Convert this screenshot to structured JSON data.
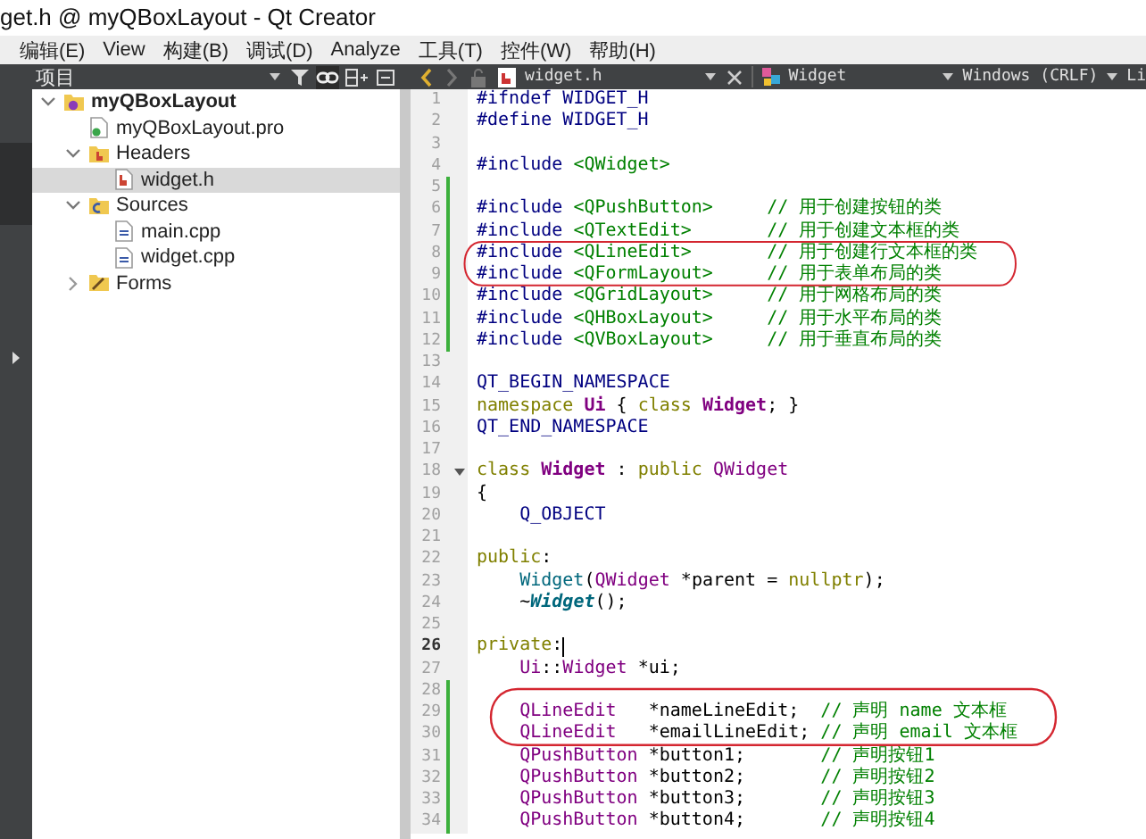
{
  "window": {
    "title": "get.h @ myQBoxLayout - Qt Creator"
  },
  "menu": [
    "编辑(E)",
    "View",
    "构建(B)",
    "调试(D)",
    "Analyze",
    "工具(T)",
    "控件(W)",
    "帮助(H)"
  ],
  "toolbar": {
    "panel_title": "项目",
    "file": "widget.h",
    "symbol": "Widget",
    "line_endings": "Windows (CRLF)",
    "combo_4": "Li"
  },
  "project_tree": {
    "items": [
      {
        "label": "myQBoxLayout",
        "kind": "project",
        "expanded": true,
        "selected": false,
        "children": [
          {
            "label": "myQBoxLayout.pro",
            "kind": "pro",
            "selected": false
          },
          {
            "label": "Headers",
            "kind": "headers",
            "expanded": true,
            "selected": false,
            "children": [
              {
                "label": "widget.h",
                "kind": "header",
                "selected": true
              }
            ]
          },
          {
            "label": "Sources",
            "kind": "sources",
            "expanded": true,
            "selected": false,
            "children": [
              {
                "label": "main.cpp",
                "kind": "cpp",
                "selected": false
              },
              {
                "label": "widget.cpp",
                "kind": "cpp",
                "selected": false
              }
            ]
          },
          {
            "label": "Forms",
            "kind": "forms",
            "expanded": false,
            "selected": false
          }
        ]
      }
    ]
  },
  "editor": {
    "lines": [
      {
        "number": "1",
        "modified": false,
        "current": false,
        "foldable": false,
        "tokens": [
          {
            "text": "#ifndef WIDGET_H",
            "kind": "macro"
          }
        ]
      },
      {
        "number": "2",
        "modified": false,
        "current": false,
        "foldable": false,
        "tokens": [
          {
            "text": "#define WIDGET_H",
            "kind": "macro"
          }
        ]
      },
      {
        "number": "3",
        "modified": false,
        "current": false,
        "foldable": false
      },
      {
        "number": "4",
        "modified": false,
        "current": false,
        "foldable": false,
        "tokens": [
          {
            "text": "#include ",
            "kind": "macro"
          },
          {
            "text": "<QWidget>",
            "kind": "string"
          }
        ]
      },
      {
        "number": "5",
        "modified": true,
        "current": false,
        "foldable": false
      },
      {
        "number": "6",
        "modified": true,
        "current": false,
        "foldable": false,
        "tokens": [
          {
            "text": "#include ",
            "kind": "macro"
          },
          {
            "text": "<QPushButton>     ",
            "kind": "string"
          },
          {
            "text": "// 用于创建按钮的类",
            "kind": "comment"
          }
        ]
      },
      {
        "number": "7",
        "modified": true,
        "current": false,
        "foldable": false,
        "tokens": [
          {
            "text": "#include ",
            "kind": "macro"
          },
          {
            "text": "<QTextEdit>       ",
            "kind": "string"
          },
          {
            "text": "// 用于创建文本框的类",
            "kind": "comment"
          }
        ]
      },
      {
        "number": "8",
        "modified": true,
        "current": false,
        "foldable": false,
        "tokens": [
          {
            "text": "#include ",
            "kind": "macro"
          },
          {
            "text": "<QLineEdit>       ",
            "kind": "string"
          },
          {
            "text": "// 用于创建行文本框的类",
            "kind": "comment"
          }
        ]
      },
      {
        "number": "9",
        "modified": true,
        "current": false,
        "foldable": false,
        "tokens": [
          {
            "text": "#include ",
            "kind": "macro"
          },
          {
            "text": "<QFormLayout>     ",
            "kind": "string"
          },
          {
            "text": "// 用于表单布局的类",
            "kind": "comment"
          }
        ]
      },
      {
        "number": "10",
        "modified": true,
        "current": false,
        "foldable": false,
        "tokens": [
          {
            "text": "#include ",
            "kind": "macro"
          },
          {
            "text": "<QGridLayout>     ",
            "kind": "string"
          },
          {
            "text": "// 用于网格布局的类",
            "kind": "comment"
          }
        ]
      },
      {
        "number": "11",
        "modified": true,
        "current": false,
        "foldable": false,
        "tokens": [
          {
            "text": "#include ",
            "kind": "macro"
          },
          {
            "text": "<QHBoxLayout>     ",
            "kind": "string"
          },
          {
            "text": "// 用于水平布局的类",
            "kind": "comment"
          }
        ]
      },
      {
        "number": "12",
        "modified": true,
        "current": false,
        "foldable": false,
        "tokens": [
          {
            "text": "#include ",
            "kind": "macro"
          },
          {
            "text": "<QVBoxLayout>     ",
            "kind": "string"
          },
          {
            "text": "// 用于垂直布局的类",
            "kind": "comment"
          }
        ]
      },
      {
        "number": "13",
        "modified": false,
        "current": false,
        "foldable": false
      },
      {
        "number": "14",
        "modified": false,
        "current": false,
        "foldable": false,
        "tokens": [
          {
            "text": "QT_BEGIN_NAMESPACE",
            "kind": "macro"
          }
        ]
      },
      {
        "number": "15",
        "modified": false,
        "current": false,
        "foldable": false,
        "tokens": [
          {
            "text": "namespace ",
            "kind": "keyword"
          },
          {
            "text": "Ui",
            "kind": "type_bold"
          },
          {
            "text": " { ",
            "kind": "plain"
          },
          {
            "text": "class ",
            "kind": "keyword"
          },
          {
            "text": "Widget",
            "kind": "type_bold"
          },
          {
            "text": "; }",
            "kind": "plain"
          }
        ]
      },
      {
        "number": "16",
        "modified": false,
        "current": false,
        "foldable": false,
        "tokens": [
          {
            "text": "QT_END_NAMESPACE",
            "kind": "macro"
          }
        ]
      },
      {
        "number": "17",
        "modified": false,
        "current": false,
        "foldable": false
      },
      {
        "number": "18",
        "modified": false,
        "current": false,
        "foldable": true,
        "tokens": [
          {
            "text": "class ",
            "kind": "keyword"
          },
          {
            "text": "Widget",
            "kind": "type_bold"
          },
          {
            "text": " : ",
            "kind": "plain"
          },
          {
            "text": "public ",
            "kind": "keyword"
          },
          {
            "text": "QWidget",
            "kind": "type"
          }
        ]
      },
      {
        "number": "19",
        "modified": false,
        "current": false,
        "foldable": false,
        "tokens": [
          {
            "text": "{",
            "kind": "plain"
          }
        ]
      },
      {
        "number": "20",
        "modified": false,
        "current": false,
        "foldable": false,
        "tokens": [
          {
            "text": "    Q_OBJECT",
            "kind": "macro"
          }
        ]
      },
      {
        "number": "21",
        "modified": false,
        "current": false,
        "foldable": false
      },
      {
        "number": "22",
        "modified": false,
        "current": false,
        "foldable": false,
        "tokens": [
          {
            "text": "public",
            "kind": "keyword"
          },
          {
            "text": ":",
            "kind": "plain"
          }
        ]
      },
      {
        "number": "23",
        "modified": false,
        "current": false,
        "foldable": false,
        "tokens": [
          {
            "text": "    Widget",
            "kind": "function"
          },
          {
            "text": "(",
            "kind": "plain"
          },
          {
            "text": "QWidget",
            "kind": "type"
          },
          {
            "text": " *parent = ",
            "kind": "plain"
          },
          {
            "text": "nullptr",
            "kind": "keyword"
          },
          {
            "text": ");",
            "kind": "plain"
          }
        ]
      },
      {
        "number": "24",
        "modified": false,
        "current": false,
        "foldable": false,
        "tokens": [
          {
            "text": "    ~",
            "kind": "plain"
          },
          {
            "text": "Widget",
            "kind": "function_italic"
          },
          {
            "text": "();",
            "kind": "plain"
          }
        ]
      },
      {
        "number": "25",
        "modified": false,
        "current": false,
        "foldable": false
      },
      {
        "number": "26",
        "modified": false,
        "current": true,
        "foldable": false,
        "tokens": [
          {
            "text": "private",
            "kind": "keyword"
          },
          {
            "text": ":",
            "kind": "plain"
          }
        ]
      },
      {
        "number": "27",
        "modified": false,
        "current": false,
        "foldable": false,
        "tokens": [
          {
            "text": "    Ui",
            "kind": "type"
          },
          {
            "text": "::",
            "kind": "plain"
          },
          {
            "text": "Widget",
            "kind": "type"
          },
          {
            "text": " *ui;",
            "kind": "plain"
          }
        ]
      },
      {
        "number": "28",
        "modified": true,
        "current": false,
        "foldable": false
      },
      {
        "number": "29",
        "modified": true,
        "current": false,
        "foldable": false,
        "tokens": [
          {
            "text": "    QLineEdit",
            "kind": "type"
          },
          {
            "text": "   *nameLineEdit;  ",
            "kind": "plain"
          },
          {
            "text": "// 声明 name 文本框",
            "kind": "comment"
          }
        ]
      },
      {
        "number": "30",
        "modified": true,
        "current": false,
        "foldable": false,
        "tokens": [
          {
            "text": "    QLineEdit",
            "kind": "type"
          },
          {
            "text": "   *emailLineEdit; ",
            "kind": "plain"
          },
          {
            "text": "// 声明 email 文本框",
            "kind": "comment"
          }
        ]
      },
      {
        "number": "31",
        "modified": true,
        "current": false,
        "foldable": false,
        "tokens": [
          {
            "text": "    QPushButton",
            "kind": "type"
          },
          {
            "text": " *button1;       ",
            "kind": "plain"
          },
          {
            "text": "// 声明按钮1",
            "kind": "comment"
          }
        ]
      },
      {
        "number": "32",
        "modified": true,
        "current": false,
        "foldable": false,
        "tokens": [
          {
            "text": "    QPushButton",
            "kind": "type"
          },
          {
            "text": " *button2;       ",
            "kind": "plain"
          },
          {
            "text": "// 声明按钮2",
            "kind": "comment"
          }
        ]
      },
      {
        "number": "33",
        "modified": true,
        "current": false,
        "foldable": false,
        "tokens": [
          {
            "text": "    QPushButton",
            "kind": "type"
          },
          {
            "text": " *button3;       ",
            "kind": "plain"
          },
          {
            "text": "// 声明按钮3",
            "kind": "comment"
          }
        ]
      },
      {
        "number": "34",
        "modified": true,
        "current": false,
        "foldable": false,
        "tokens": [
          {
            "text": "    QPushButton",
            "kind": "type"
          },
          {
            "text": " *button4;       ",
            "kind": "plain"
          },
          {
            "text": "// 声明按钮4",
            "kind": "comment"
          }
        ]
      }
    ]
  }
}
